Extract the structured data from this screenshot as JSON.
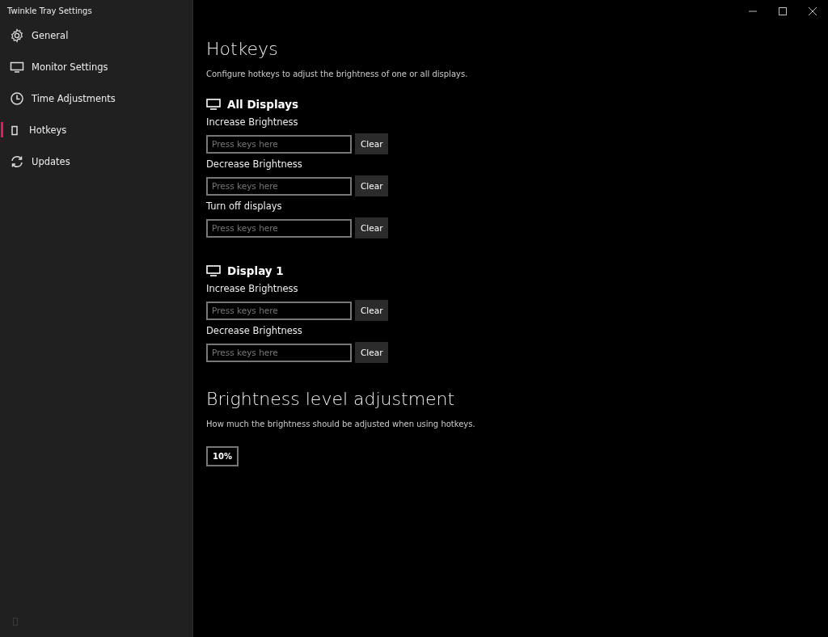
{
  "window": {
    "title": "Twinkle Tray Settings"
  },
  "sidebar": {
    "items": [
      {
        "label": "General",
        "selected": false
      },
      {
        "label": "Monitor Settings",
        "selected": false
      },
      {
        "label": "Time Adjustments",
        "selected": false
      },
      {
        "label": "Hotkeys",
        "selected": true
      },
      {
        "label": "Updates",
        "selected": false
      }
    ]
  },
  "page": {
    "title": "Hotkeys",
    "description": "Configure hotkeys to adjust the brightness of one or all displays.",
    "groups": [
      {
        "title": "All Displays",
        "hotkeys": [
          {
            "label": "Increase Brightness",
            "placeholder": "Press keys here",
            "button": "Clear"
          },
          {
            "label": "Decrease Brightness",
            "placeholder": "Press keys here",
            "button": "Clear"
          },
          {
            "label": "Turn off displays",
            "placeholder": "Press keys here",
            "button": "Clear"
          }
        ]
      },
      {
        "title": "Display 1",
        "hotkeys": [
          {
            "label": "Increase Brightness",
            "placeholder": "Press keys here",
            "button": "Clear"
          },
          {
            "label": "Decrease Brightness",
            "placeholder": "Press keys here",
            "button": "Clear"
          }
        ]
      }
    ]
  },
  "adjustment": {
    "title": "Brightness level adjustment",
    "description": "How much the brightness should be adjusted when using hotkeys.",
    "value": "10%"
  }
}
